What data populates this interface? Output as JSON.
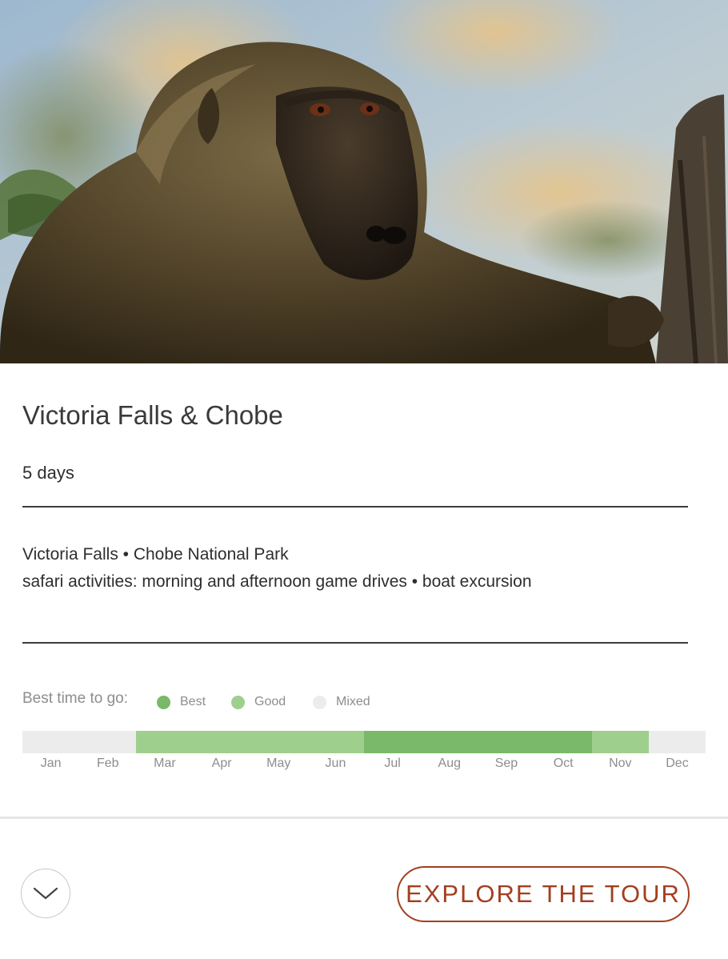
{
  "hero": {
    "image": "baboon-photo"
  },
  "tour": {
    "title": "Victoria Falls & Chobe",
    "duration": "5 days",
    "destinations": "Victoria Falls • Chobe National Park",
    "activities": "safari activities: morning and afternoon game drives • boat excursion"
  },
  "season": {
    "label": "Best time to go:",
    "legend": [
      {
        "key": "best",
        "label": "Best",
        "color": "#7ab86a"
      },
      {
        "key": "good",
        "label": "Good",
        "color": "#9fcf8c"
      },
      {
        "key": "mixed",
        "label": "Mixed",
        "color": "#ececec"
      }
    ],
    "months": [
      {
        "label": "Jan",
        "rating": "mixed"
      },
      {
        "label": "Feb",
        "rating": "mixed"
      },
      {
        "label": "Mar",
        "rating": "good"
      },
      {
        "label": "Apr",
        "rating": "good"
      },
      {
        "label": "May",
        "rating": "good"
      },
      {
        "label": "Jun",
        "rating": "good"
      },
      {
        "label": "Jul",
        "rating": "best"
      },
      {
        "label": "Aug",
        "rating": "best"
      },
      {
        "label": "Sep",
        "rating": "best"
      },
      {
        "label": "Oct",
        "rating": "best"
      },
      {
        "label": "Nov",
        "rating": "good"
      },
      {
        "label": "Dec",
        "rating": "mixed"
      }
    ]
  },
  "actions": {
    "expand_icon": "chevron-down-icon",
    "explore_label": "EXPLORE THE TOUR",
    "accent_color": "#a33f1f"
  }
}
